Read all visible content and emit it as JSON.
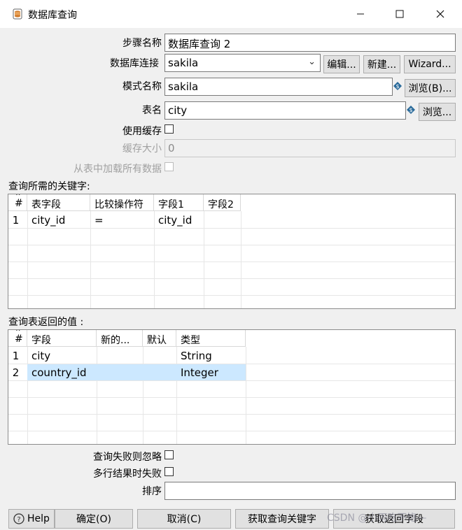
{
  "window": {
    "title": "数据库查询",
    "minimize_icon": "minimize-icon",
    "maximize_icon": "maximize-icon",
    "close_icon": "close-icon"
  },
  "form": {
    "step_name_label": "步骤名称",
    "step_name_value": "数据库查询 2",
    "connection_label": "数据库连接",
    "connection_value": "sakila",
    "edit_button": "编辑...",
    "new_button": "新建...",
    "wizard_button": "Wizard...",
    "schema_label": "模式名称",
    "schema_value": "sakila",
    "schema_browse_button": "浏览(B)...",
    "table_label": "表名",
    "table_value": "city",
    "table_browse_button": "浏览...",
    "use_cache_label": "使用缓存",
    "cache_size_label": "缓存大小",
    "cache_size_value": "0",
    "load_all_label": "从表中加载所有数据"
  },
  "keys_section": {
    "title": "查询所需的关键字:",
    "columns": [
      "#",
      "表字段",
      "比较操作符",
      "字段1",
      "字段2"
    ],
    "rows": [
      {
        "num": "1",
        "table_field": "city_id",
        "operator": "=",
        "field1": "city_id",
        "field2": ""
      }
    ]
  },
  "return_section": {
    "title": "查询表返回的值 :",
    "columns": [
      "#",
      "字段",
      "新的...",
      "默认",
      "类型"
    ],
    "rows": [
      {
        "num": "1",
        "field": "city",
        "new_name": "",
        "default": "",
        "type": "String"
      },
      {
        "num": "2",
        "field": "country_id",
        "new_name": "",
        "default": "",
        "type": "Integer"
      }
    ]
  },
  "options": {
    "ignore_fail_label": "查询失败则忽略",
    "fail_multi_label": "多行结果时失败",
    "order_label": "排序",
    "order_value": ""
  },
  "buttons": {
    "help": "Help",
    "ok": "确定(O)",
    "cancel": "取消(C)",
    "get_keys": "获取查询关键字",
    "get_fields": "获取返回字段"
  },
  "watermark": "CSDN @小雨吃不饱—",
  "colors": {
    "accent_selection": "#cce8ff",
    "grid_gray_cell": "#e8e8e8",
    "variable_icon": "#2a6a9a"
  }
}
